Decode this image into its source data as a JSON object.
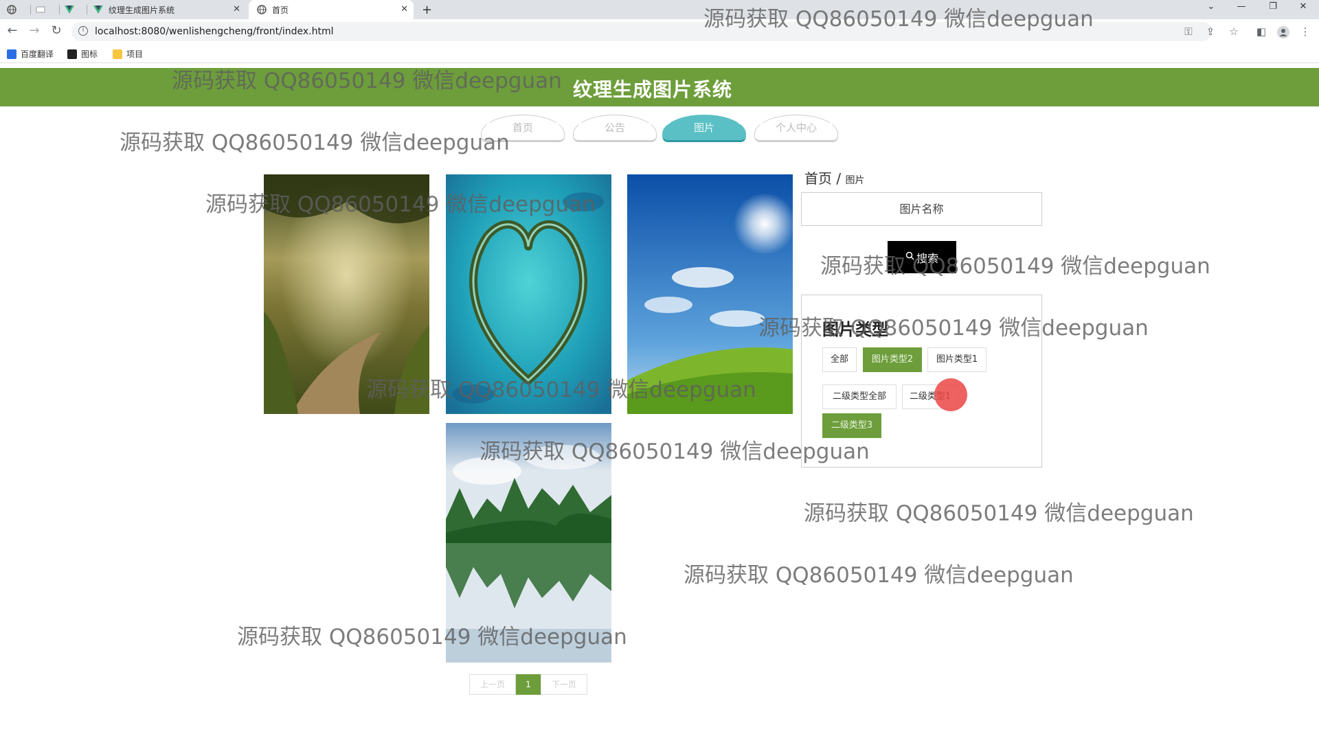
{
  "browser": {
    "tabs": [
      {
        "label": "",
        "icon": "globe-icon"
      },
      {
        "label": "",
        "icon": "blank-page-icon"
      },
      {
        "label": "",
        "icon": "vue-logo-icon"
      },
      {
        "label": "纹理生成图片系统",
        "icon": "vue-logo-icon"
      },
      {
        "label": "首页",
        "icon": "globe-icon"
      }
    ],
    "new_tab": "+",
    "url": "localhost:8080/wenlishengcheng/front/index.html",
    "bookmarks": [
      {
        "label": "百度翻译",
        "color": "#2b6de5"
      },
      {
        "label": "图标",
        "color": "#222222"
      },
      {
        "label": "项目",
        "color": "#f5c542"
      }
    ]
  },
  "site": {
    "title": "纹理生成图片系统",
    "accent_color": "#6d9e3b",
    "active_tab_color": "#5bc0c5"
  },
  "nav": [
    {
      "label": "首页",
      "active": false
    },
    {
      "label": "公告",
      "active": false
    },
    {
      "label": "图片",
      "active": true
    },
    {
      "label": "个人中心",
      "active": false
    }
  ],
  "gallery": [
    {
      "name": "forest-path"
    },
    {
      "name": "heart-island"
    },
    {
      "name": "blue-sky-meadow"
    },
    {
      "name": "karst-lake"
    }
  ],
  "breadcrumb": {
    "home": "首页",
    "separator": "/",
    "current": "图片"
  },
  "search": {
    "placeholder": "图片名称",
    "button_label": "搜索"
  },
  "filter": {
    "title": "图片类型",
    "types": [
      {
        "label": "全部",
        "selected": false
      },
      {
        "label": "图片类型2",
        "selected": true
      },
      {
        "label": "图片类型1",
        "selected": false
      }
    ],
    "subtypes": [
      {
        "label": "二级类型全部",
        "selected": false
      },
      {
        "label": "二级类型1",
        "selected": false
      },
      {
        "label": "二级类型3",
        "selected": true
      }
    ]
  },
  "pagination": {
    "prev": "上一页",
    "current": "1",
    "next": "下一页"
  },
  "watermark": "源码获取 QQ86050149 微信deepguan"
}
